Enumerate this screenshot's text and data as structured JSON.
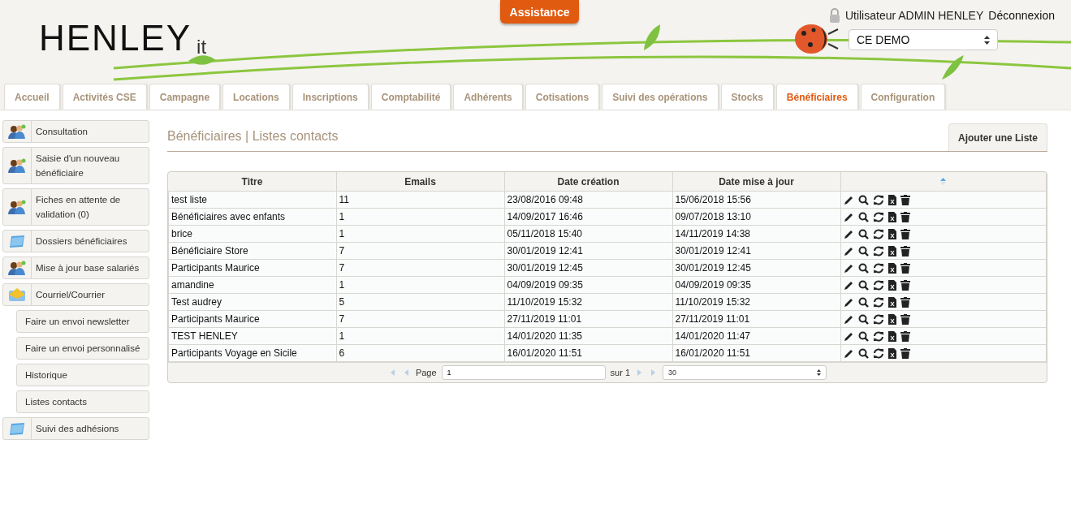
{
  "header": {
    "logo": {
      "text": "HENLEY",
      "suffix": "it"
    },
    "assist_button": "Assistance",
    "user_label": "Utilisateur ADMIN HENLEY",
    "logout_link": "Déconnexion",
    "org_select": "CE DEMO"
  },
  "tabs": [
    {
      "label": "Accueil",
      "selected": false
    },
    {
      "label": "Activités CSE",
      "selected": false
    },
    {
      "label": "Campagne",
      "selected": false
    },
    {
      "label": "Locations",
      "selected": false
    },
    {
      "label": "Inscriptions",
      "selected": false
    },
    {
      "label": "Comptabilité",
      "selected": false
    },
    {
      "label": "Adhérents",
      "selected": false
    },
    {
      "label": "Cotisations",
      "selected": false
    },
    {
      "label": "Suivi des opérations",
      "selected": false
    },
    {
      "label": "Stocks",
      "selected": false
    },
    {
      "label": "Bénéficiaires",
      "selected": true
    },
    {
      "label": "Configuration",
      "selected": false
    }
  ],
  "sidebar": {
    "items": [
      {
        "kind": "people",
        "label": "Consultation"
      },
      {
        "kind": "people",
        "label": "Saisie d'un nouveau bénéficiaire"
      },
      {
        "kind": "people",
        "label": "Fiches en attente de validation (0)"
      },
      {
        "kind": "folder",
        "label": "Dossiers bénéficiaires"
      },
      {
        "kind": "people",
        "label": "Mise à jour base salariés"
      },
      {
        "kind": "mail",
        "label": "Courriel/Courrier"
      },
      {
        "kind": "sub",
        "label": "Faire un envoi newsletter"
      },
      {
        "kind": "sub",
        "label": "Faire un envoi personnalisé"
      },
      {
        "kind": "sub",
        "label": "Historique"
      },
      {
        "kind": "sub",
        "label": "Listes contacts"
      },
      {
        "kind": "folder",
        "label": "Suivi des adhésions"
      }
    ]
  },
  "page": {
    "title": "Bénéficiaires | Listes contacts",
    "add_button": "Ajouter une Liste"
  },
  "table": {
    "columns": [
      "Titre",
      "Emails",
      "Date création",
      "Date mise à jour"
    ],
    "rows": [
      [
        "test liste",
        "11",
        "23/08/2016 09:48",
        "15/06/2018 15:56"
      ],
      [
        "Bénéficiaires avec enfants",
        "1",
        "14/09/2017 16:46",
        "09/07/2018 13:10"
      ],
      [
        "brice",
        "1",
        "05/11/2018 15:40",
        "14/11/2019 14:38"
      ],
      [
        "Bénéficiaire Store",
        "7",
        "30/01/2019 12:41",
        "30/01/2019 12:41"
      ],
      [
        "Participants Maurice",
        "7",
        "30/01/2019 12:45",
        "30/01/2019 12:45"
      ],
      [
        "amandine",
        "1",
        "04/09/2019 09:35",
        "04/09/2019 09:35"
      ],
      [
        "Test audrey",
        "5",
        "11/10/2019 15:32",
        "11/10/2019 15:32"
      ],
      [
        "Participants Maurice",
        "7",
        "27/11/2019 11:01",
        "27/11/2019 11:01"
      ],
      [
        "TEST HENLEY",
        "1",
        "14/01/2020 11:35",
        "14/01/2020 11:47"
      ],
      [
        "Participants Voyage en Sicile",
        "6",
        "16/01/2020 11:51",
        "16/01/2020 11:51"
      ]
    ]
  },
  "pager": {
    "page_label": "Page",
    "page_value": "1",
    "of_label": "sur 1",
    "page_size": "30"
  }
}
